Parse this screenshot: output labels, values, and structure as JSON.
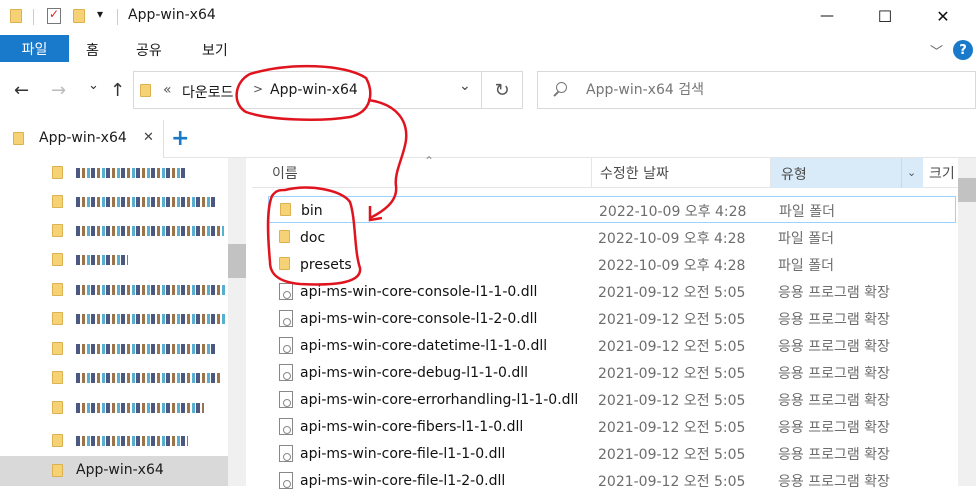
{
  "window": {
    "title": "App-win-x64",
    "qat_dropdown": "▾",
    "controls": {
      "minimize": "—",
      "maximize": "☐",
      "close": "✕"
    }
  },
  "ribbon": {
    "file_tab": "파일",
    "tabs": [
      "홈",
      "공유",
      "보기"
    ],
    "expand_glyph": "﹀",
    "help": "?"
  },
  "nav": {
    "back": "←",
    "forward": "→",
    "recent": "⌄",
    "up": "↑",
    "refresh": "↻"
  },
  "address": {
    "overflow": "«",
    "crumbs": [
      "다운로드",
      "App-win-x64"
    ],
    "separator": ">",
    "dropdown": "⌄"
  },
  "search": {
    "placeholder": "App-win-x64 검색"
  },
  "tabs": {
    "active_label": "App-win-x64",
    "close": "✕",
    "add": "+"
  },
  "sidebar": {
    "active_item": "App-win-x64"
  },
  "columns": {
    "name": "이름",
    "date": "수정한 날짜",
    "type": "유형",
    "size": "크기",
    "sort_glyph": "⌃"
  },
  "files": [
    {
      "name": "bin",
      "date": "2022-10-09 오후 4:28",
      "type": "파일 폴더",
      "kind": "folder"
    },
    {
      "name": "doc",
      "date": "2022-10-09 오후 4:28",
      "type": "파일 폴더",
      "kind": "folder"
    },
    {
      "name": "presets",
      "date": "2022-10-09 오후 4:28",
      "type": "파일 폴더",
      "kind": "folder"
    },
    {
      "name": "api-ms-win-core-console-l1-1-0.dll",
      "date": "2021-09-12 오전 5:05",
      "type": "응용 프로그램 확장",
      "kind": "dll"
    },
    {
      "name": "api-ms-win-core-console-l1-2-0.dll",
      "date": "2021-09-12 오전 5:05",
      "type": "응용 프로그램 확장",
      "kind": "dll"
    },
    {
      "name": "api-ms-win-core-datetime-l1-1-0.dll",
      "date": "2021-09-12 오전 5:05",
      "type": "응용 프로그램 확장",
      "kind": "dll"
    },
    {
      "name": "api-ms-win-core-debug-l1-1-0.dll",
      "date": "2021-09-12 오전 5:05",
      "type": "응용 프로그램 확장",
      "kind": "dll"
    },
    {
      "name": "api-ms-win-core-errorhandling-l1-1-0.dll",
      "date": "2021-09-12 오전 5:05",
      "type": "응용 프로그램 확장",
      "kind": "dll"
    },
    {
      "name": "api-ms-win-core-fibers-l1-1-0.dll",
      "date": "2021-09-12 오전 5:05",
      "type": "응용 프로그램 확장",
      "kind": "dll"
    },
    {
      "name": "api-ms-win-core-file-l1-1-0.dll",
      "date": "2021-09-12 오전 5:05",
      "type": "응용 프로그램 확장",
      "kind": "dll"
    },
    {
      "name": "api-ms-win-core-file-l1-2-0.dll",
      "date": "2021-09-12 오전 5:05",
      "type": "응용 프로그램 확장",
      "kind": "dll"
    }
  ],
  "colors": {
    "accent": "#1979ca",
    "annotation": "#e0141e",
    "selection": "#cce8ff"
  }
}
